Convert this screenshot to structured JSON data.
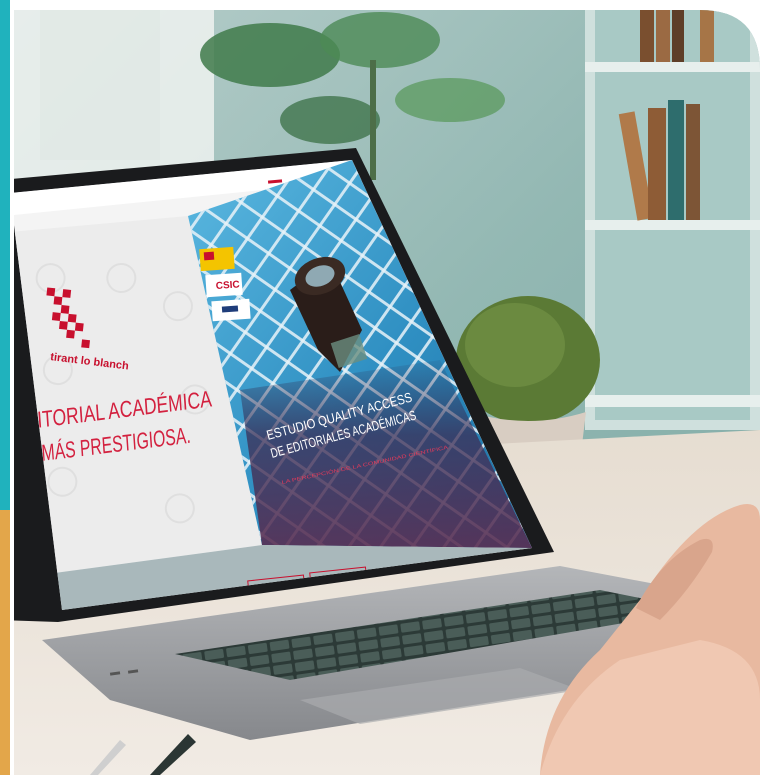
{
  "scene": {
    "colors": {
      "accent_teal": "#20b2bd",
      "accent_amber": "#e3a64a",
      "brand_red": "#c8102e",
      "wall": "#8fb6b0",
      "desk": "#e9dfd2",
      "laptop": "#9c9ea2",
      "pattern_blue": "#3fa3cf"
    }
  },
  "website": {
    "header_links": [
      "",
      "",
      ""
    ],
    "search_button": "",
    "brand": {
      "logo_icon": "tirant-lo-blanch-logo-icon",
      "name": "tirant lo blanch"
    },
    "hero": {
      "headline_line1": "EDITORIAL ACADÉMICA",
      "headline_line2": "MÁS PRESTIGIOSA."
    },
    "badges": [
      "",
      "CSIC",
      ""
    ],
    "banner": {
      "title_line1": "ESTUDIO QUALITY ACCESS",
      "title_line2": "DE EDITORIALES ACADÉMICAS",
      "subtitle": "LA PERCEPCIÓN DE LA COMUNIDAD CIENTÍFICA"
    },
    "footer_text": "",
    "footer_buttons": [
      "",
      ""
    ]
  }
}
